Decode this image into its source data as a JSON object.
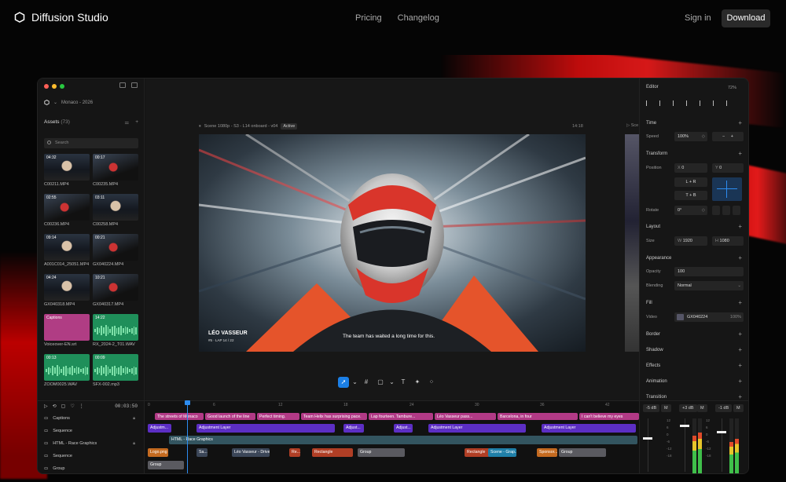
{
  "nav": {
    "brand": "Diffusion Studio",
    "links": [
      "Pricing",
      "Changelog"
    ],
    "signin": "Sign in",
    "download": "Download"
  },
  "project": {
    "name": "Monaco - 2026"
  },
  "assets": {
    "title": "Assets",
    "count": "(73)",
    "search_placeholder": "Search",
    "items": [
      {
        "dur": "04:32",
        "name": "C00211.MP4",
        "kind": "person"
      },
      {
        "dur": "00:17",
        "name": "C00235.MP4",
        "kind": "car"
      },
      {
        "dur": "02:55",
        "name": "C00236.MP4",
        "kind": "car"
      },
      {
        "dur": "03:11",
        "name": "C00258.MP4",
        "kind": "person"
      },
      {
        "dur": "09:14",
        "name": "A001C014_25051.MP4",
        "kind": "person"
      },
      {
        "dur": "00:21",
        "name": "GX040224.MP4",
        "kind": "car"
      },
      {
        "dur": "04:24",
        "name": "GX040318.MP4",
        "kind": "person"
      },
      {
        "dur": "10:21",
        "name": "GX040317.MP4",
        "kind": "car"
      },
      {
        "dur": "Captions",
        "name": "Voiceover-EN.srt",
        "kind": "cap"
      },
      {
        "dur": "14:22",
        "name": "RX_2024-2_T01.WAV",
        "kind": "aud"
      },
      {
        "dur": "00:13",
        "name": "ZOOM0025.WAV",
        "kind": "aud"
      },
      {
        "dur": "00:09",
        "name": "SFX-002.mp3",
        "kind": "aud"
      }
    ]
  },
  "scene": {
    "header": "Scene 1080p - S3 - L14 onboard - v04",
    "status": "Active",
    "time": "14:18",
    "next": "Sce",
    "driver": "LÉO VASSEUR",
    "driver_sub": "#5 · LAP 14 / 22",
    "subtitle": "The team has waited a long time for this."
  },
  "editor": {
    "title": "Editor",
    "zoom": "72%",
    "time_label": "Time",
    "speed_label": "Speed",
    "speed": "100%",
    "transform_label": "Transform",
    "position_label": "Position",
    "x": "0",
    "y": "0",
    "x_prefix": "X",
    "y_prefix": "Y",
    "lr": "L + R",
    "tb": "T + B",
    "rotate_label": "Rotate",
    "rotate": "0°",
    "layout_label": "Layout",
    "size_label": "Size",
    "w": "1920",
    "h": "1080",
    "w_prefix": "W",
    "h_prefix": "H",
    "appearance_label": "Appearance",
    "opacity_label": "Opacity",
    "opacity": "100",
    "blending_label": "Blending",
    "blending": "Normal",
    "fill_label": "Fill",
    "video_label": "Video",
    "video_src": "GX040224",
    "video_pct": "100%",
    "border_label": "Border",
    "shadow_label": "Shadow",
    "effects_label": "Effects",
    "animation_label": "Animation",
    "transition_label": "Transition"
  },
  "timeline": {
    "time": "00:03:50",
    "tracks": [
      "Captions",
      "Sequence",
      "HTML - Race Graphics",
      "Sequence",
      "Group"
    ],
    "ruler": [
      "0",
      "6",
      "12",
      "18",
      "24",
      "30",
      "36",
      "42"
    ],
    "captions": [
      "The streets of Monaco",
      "Good launch of the line",
      "Perfect timing.",
      "Team Helix has surprising pace.",
      "Lap fourteen. Tambure...",
      "Léo Vasseur pass...",
      "Barcelona, in four",
      "I can't believe my eyes"
    ],
    "adjust": [
      "Adjustm...",
      "Adjustment Layer",
      "Adjust...",
      "Adjust...",
      "Adjustment Layer",
      "Adjustment Layer"
    ],
    "html_label": "HTML - Race Graphics",
    "row4": [
      "Logo.png",
      "Sa...",
      "Léo Vasseur - Driver...",
      "Re...",
      "Rectangle",
      "Group",
      "Rectangle",
      "Scene - Grap...",
      "Sponsor...",
      "Group"
    ],
    "row5": [
      "Group"
    ]
  },
  "mixer": {
    "db": [
      "-5 dB",
      "+3 dB",
      "-1 dB"
    ],
    "m": "M",
    "scale": [
      "12",
      "6",
      "0",
      "-6",
      "-12",
      "-18"
    ]
  }
}
